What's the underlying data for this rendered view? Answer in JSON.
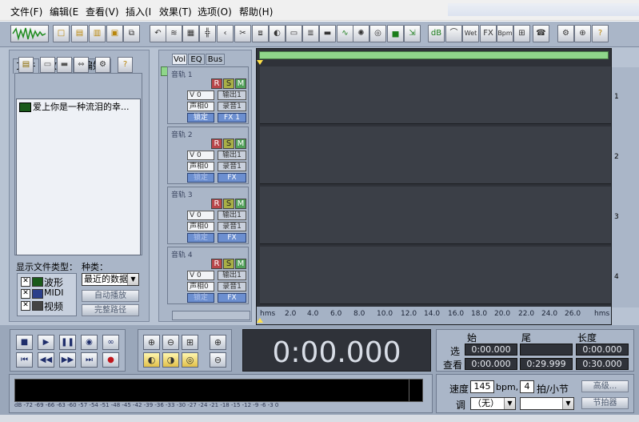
{
  "menu": [
    "文件(F)",
    "编辑(E",
    "查看(V)",
    "插入(I",
    "效果(T)",
    "选项(O)",
    "帮助(H)"
  ],
  "toolbar": {
    "buttons": [
      {
        "name": "new-button",
        "g": "□",
        "c": "ylw"
      },
      {
        "name": "open-button",
        "g": "▤",
        "c": "ylw"
      },
      {
        "name": "open-session-button",
        "g": "▥",
        "c": "ylw"
      },
      {
        "name": "save-button",
        "g": "▣",
        "c": "ylw"
      },
      {
        "name": "save-all-button",
        "g": "⧉",
        "c": ""
      },
      {
        "name": "undo-button",
        "g": "↶",
        "c": ""
      },
      {
        "name": "mix-button",
        "g": "≋",
        "c": ""
      },
      {
        "name": "snapshot-button",
        "g": "▦",
        "c": ""
      },
      {
        "name": "tile-button",
        "g": "╬",
        "c": ""
      },
      {
        "name": "cursor-button",
        "g": "‹",
        "c": ""
      },
      {
        "name": "cut-button",
        "g": "✂",
        "c": ""
      },
      {
        "name": "copy-button",
        "g": "⧈",
        "c": ""
      },
      {
        "name": "envelope-button",
        "g": "◐",
        "c": ""
      },
      {
        "name": "marker-button",
        "g": "▭",
        "c": ""
      },
      {
        "name": "fade-button",
        "g": "≣",
        "c": ""
      },
      {
        "name": "level-button",
        "g": "▬",
        "c": ""
      },
      {
        "name": "wave-button",
        "g": "∿",
        "c": "grn"
      },
      {
        "name": "noise-button",
        "g": "✺",
        "c": ""
      },
      {
        "name": "cd-button",
        "g": "◎",
        "c": ""
      },
      {
        "name": "spectrum-button",
        "g": "▅",
        "c": "grn"
      },
      {
        "name": "convert-button",
        "g": "⇲",
        "c": "grn"
      },
      {
        "name": "db-button",
        "g": "dB",
        "c": "grn"
      },
      {
        "name": "stretch-button",
        "g": "⌒",
        "c": ""
      },
      {
        "name": "wet-button",
        "g": "Wet",
        "c": ""
      },
      {
        "name": "fx-button",
        "g": "FX",
        "c": ""
      },
      {
        "name": "bpm-button",
        "g": "Bpm",
        "c": ""
      },
      {
        "name": "cdrom-button",
        "g": "⊞",
        "c": ""
      },
      {
        "name": "phone-button",
        "g": "☎",
        "c": ""
      },
      {
        "name": "options-button",
        "g": "⚙",
        "c": ""
      },
      {
        "name": "loop-button",
        "g": "⊕",
        "c": ""
      },
      {
        "name": "help-button",
        "g": "?",
        "c": "ylw"
      }
    ]
  },
  "left_panel": {
    "tabs": [
      "文件",
      "效果",
      "偏好"
    ],
    "files": [
      "爱上你是一种流泪的幸..."
    ],
    "show_type_label": "显示文件类型：",
    "category_label": "种类：",
    "types": [
      "波形",
      "MIDI",
      "视频"
    ],
    "category_value": "最近的数据",
    "auto_play": "自动播放",
    "full_path": "完整路径"
  },
  "mixer_tabs": [
    "Vol",
    "EQ",
    "Bus"
  ],
  "tracks": [
    {
      "name": "音轨 1",
      "vol": "V 0",
      "pan": "声相0",
      "out": "输出1",
      "rec": "录音1",
      "lock": "锁定",
      "fx": "FX 1",
      "lane": "1"
    },
    {
      "name": "音轨 2",
      "vol": "V 0",
      "pan": "声相0",
      "out": "输出1",
      "rec": "录音1",
      "lock": "锁定",
      "fx": "FX",
      "lane": "2"
    },
    {
      "name": "音轨 3",
      "vol": "V 0",
      "pan": "声相0",
      "out": "输出1",
      "rec": "录音1",
      "lock": "锁定",
      "fx": "FX",
      "lane": "3"
    },
    {
      "name": "音轨 4",
      "vol": "V 0",
      "pan": "声相0",
      "out": "输出1",
      "rec": "录音1",
      "lock": "锁定",
      "fx": "FX",
      "lane": "4"
    }
  ],
  "ruler": [
    "hms",
    "2.0",
    "4.0",
    "6.0",
    "8.0",
    "10.0",
    "12.0",
    "14.0",
    "16.0",
    "18.0",
    "20.0",
    "22.0",
    "24.0",
    "26.0",
    "hms"
  ],
  "time_display": "0:00.000",
  "selection": {
    "headers": [
      "始",
      "尾",
      "长度"
    ],
    "rows": [
      {
        "label": "选",
        "start": "0:00.000",
        "end": "",
        "length": "0:00.000"
      },
      {
        "label": "查看",
        "start": "0:00.000",
        "end": "0:29.999",
        "length": "0:30.000"
      }
    ]
  },
  "meter_scale": "dB -72 -69 -66 -63 -60 -57 -54 -51 -48 -45 -42 -39 -36 -33 -30 -27 -24 -21 -18 -15 -12 -9 -6 -3 0",
  "tempo": {
    "speed_label": "速度",
    "bpm": "145",
    "bpm_unit": "bpm,",
    "beats": "4",
    "beats_unit": "拍/小节",
    "advanced": "高级...",
    "key_label": "调",
    "key_value": "（无）",
    "metronome": "节拍器"
  }
}
